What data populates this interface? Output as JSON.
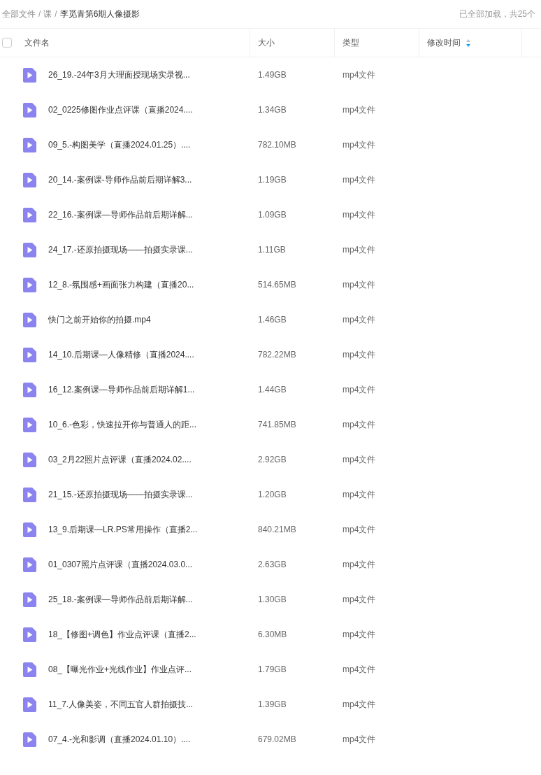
{
  "breadcrumb": {
    "items": [
      {
        "label": "全部文件",
        "current": false
      },
      {
        "label": "课",
        "current": false
      },
      {
        "label": "李觅青第6期人像摄影",
        "current": true
      }
    ],
    "separator": "/"
  },
  "load_status": "已全部加载，共25个",
  "table": {
    "select_all": {
      "checked": false
    },
    "columns": [
      {
        "label": "文件名",
        "sorted": false
      },
      {
        "label": "大小",
        "sorted": false
      },
      {
        "label": "类型",
        "sorted": false
      },
      {
        "label": "修改时间",
        "sorted": true
      }
    ],
    "rows": [
      {
        "name": "26_19.-24年3月大理面授现场实录视...",
        "size": "1.49GB",
        "type": "mp4文件"
      },
      {
        "name": "02_0225修图作业点评课（直播2024....",
        "size": "1.34GB",
        "type": "mp4文件"
      },
      {
        "name": "09_5.-构图美学（直播2024.01.25）....",
        "size": "782.10MB",
        "type": "mp4文件"
      },
      {
        "name": "20_14.-案例课-导师作品前后期详解3...",
        "size": "1.19GB",
        "type": "mp4文件"
      },
      {
        "name": "22_16.-案例课—导师作品前后期详解...",
        "size": "1.09GB",
        "type": "mp4文件"
      },
      {
        "name": "24_17.-还原拍摄现场——拍摄实录课...",
        "size": "1.11GB",
        "type": "mp4文件"
      },
      {
        "name": "12_8.-氛围感+画面张力构建（直播20...",
        "size": "514.65MB",
        "type": "mp4文件"
      },
      {
        "name": "快门之前开始你的拍摄.mp4",
        "size": "1.46GB",
        "type": "mp4文件"
      },
      {
        "name": "14_10.后期课—人像精修（直播2024....",
        "size": "782.22MB",
        "type": "mp4文件"
      },
      {
        "name": "16_12.案例课—导师作品前后期详解1...",
        "size": "1.44GB",
        "type": "mp4文件"
      },
      {
        "name": "10_6.-色彩，快速拉开你与普通人的距...",
        "size": "741.85MB",
        "type": "mp4文件"
      },
      {
        "name": "03_2月22照片点评课（直播2024.02....",
        "size": "2.92GB",
        "type": "mp4文件"
      },
      {
        "name": "21_15.-还原拍摄现场——拍摄实录课...",
        "size": "1.20GB",
        "type": "mp4文件"
      },
      {
        "name": "13_9.后期课—LR.PS常用操作（直播2...",
        "size": "840.21MB",
        "type": "mp4文件"
      },
      {
        "name": "01_0307照片点评课（直播2024.03.0...",
        "size": "2.63GB",
        "type": "mp4文件"
      },
      {
        "name": "25_18.-案例课—导师作品前后期详解...",
        "size": "1.30GB",
        "type": "mp4文件"
      },
      {
        "name": "18_【修图+调色】作业点评课（直播2...",
        "size": "6.30MB",
        "type": "mp4文件"
      },
      {
        "name": "08_【曝光作业+光线作业】作业点评...",
        "size": "1.79GB",
        "type": "mp4文件"
      },
      {
        "name": "11_7.人像美姿，不同五官人群拍摄技...",
        "size": "1.39GB",
        "type": "mp4文件"
      },
      {
        "name": "07_4.-光和影调（直播2024.01.10）....",
        "size": "679.02MB",
        "type": "mp4文件"
      }
    ]
  }
}
